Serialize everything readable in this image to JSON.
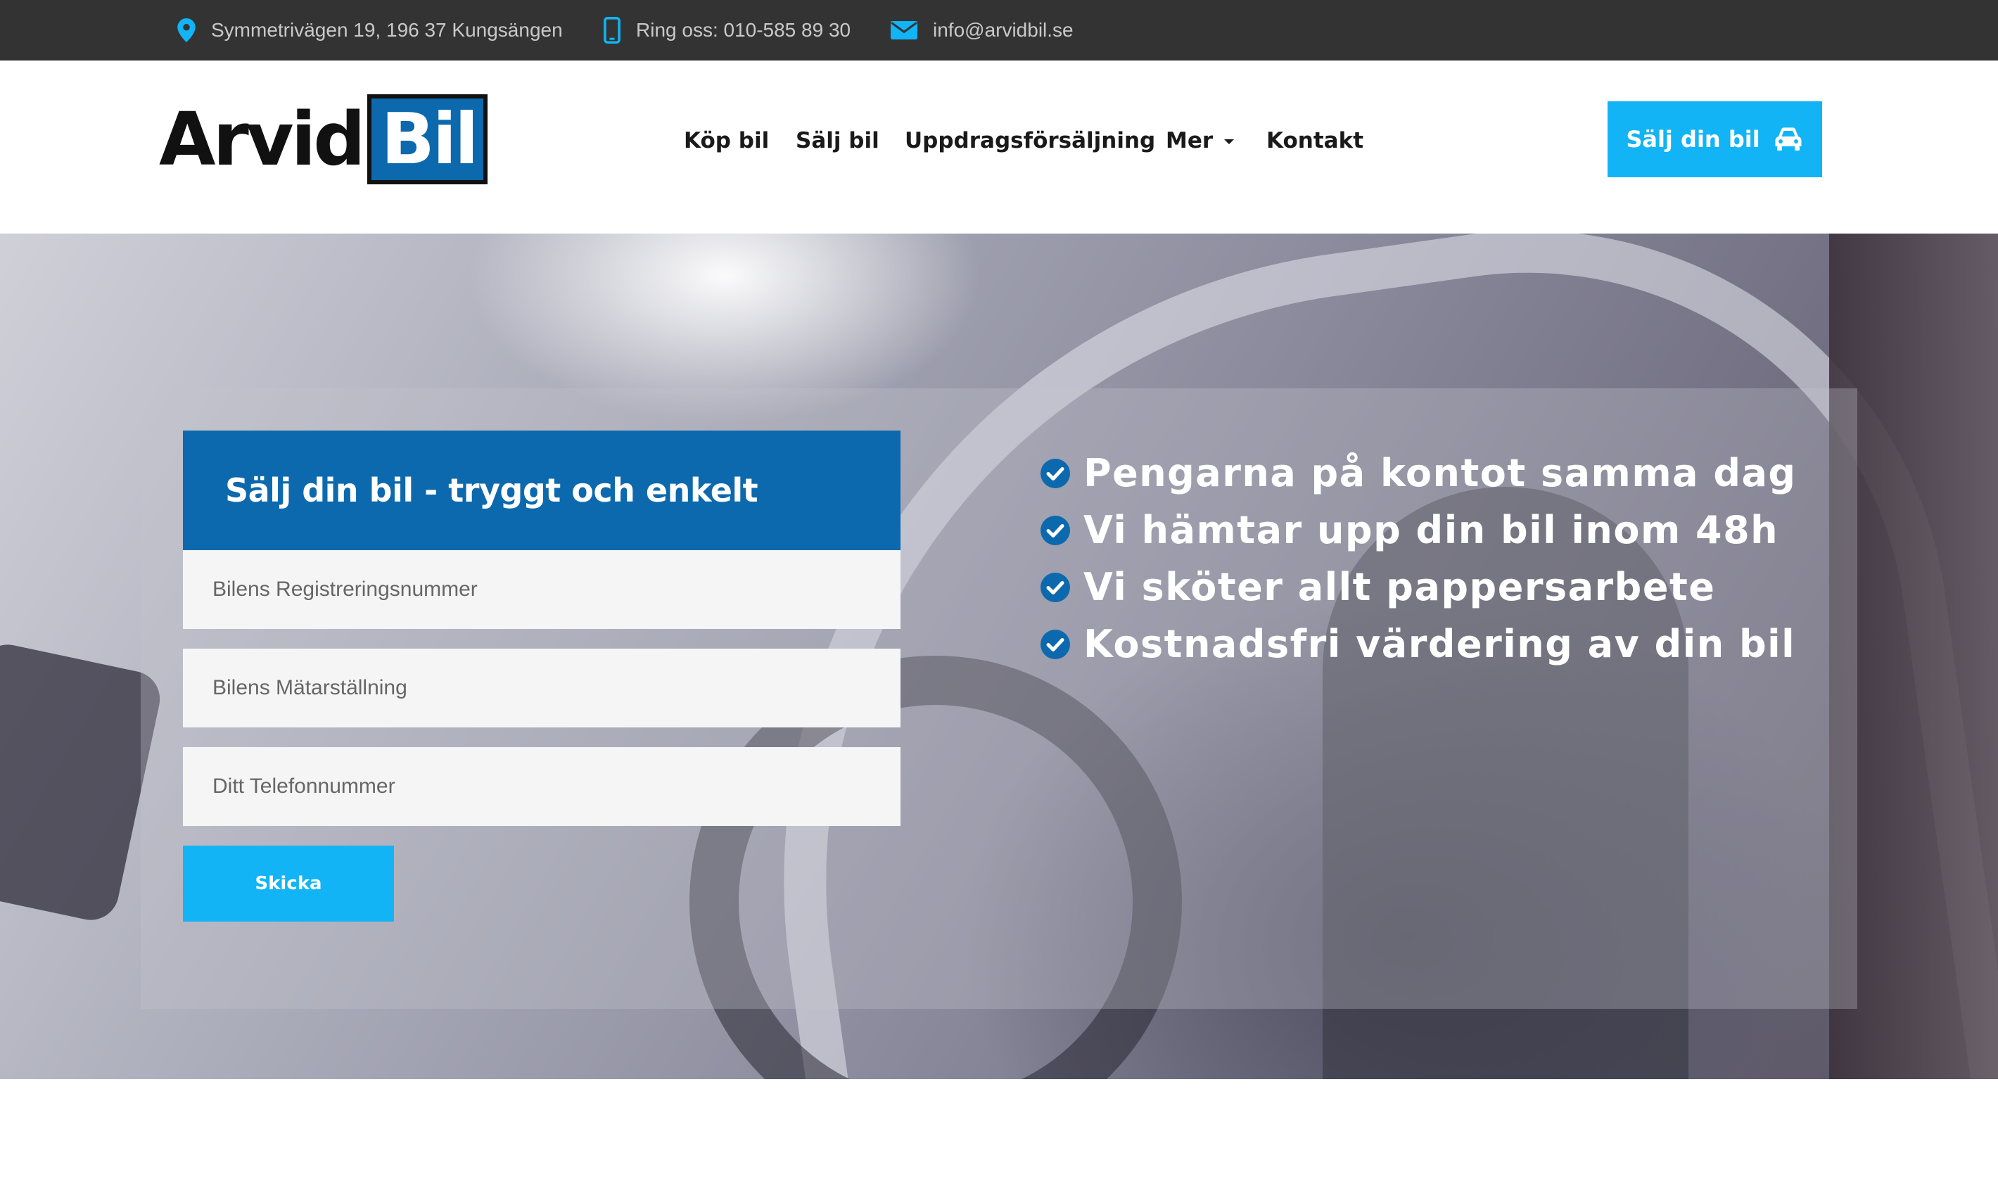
{
  "topbar": {
    "address": "Symmetrivägen 19, 196 37 Kungsängen",
    "phone": "Ring oss: 010-585 89 30",
    "email": "info@arvidbil.se",
    "icons": [
      "location-pin-icon",
      "mobile-phone-icon",
      "envelope-icon"
    ]
  },
  "brand": {
    "logo_part1": "Arvid",
    "logo_part2": "Bil",
    "colors": {
      "brand_blue": "#0c69ad",
      "accent_cyan": "#12b4f5",
      "topbar_bg": "#333333"
    }
  },
  "nav": {
    "items": [
      "Köp bil",
      "Sälj bil",
      "Uppdragsförsäljning",
      "Mer",
      "Kontakt"
    ],
    "cta_label": "Sälj din bil",
    "cta_icon": "car-icon"
  },
  "form": {
    "title": "Sälj din bil - tryggt och enkelt",
    "fields": [
      {
        "placeholder": "Bilens Registreringsnummer"
      },
      {
        "placeholder": "Bilens Mätarställning"
      },
      {
        "placeholder": "Ditt Telefonnummer"
      }
    ],
    "submit_label": "Skicka"
  },
  "benefits": [
    "Pengarna på kontot samma dag",
    "Vi hämtar upp din bil inom 48h",
    "Vi sköter allt pappersarbete",
    "Kostnadsfri värdering av din bil"
  ]
}
